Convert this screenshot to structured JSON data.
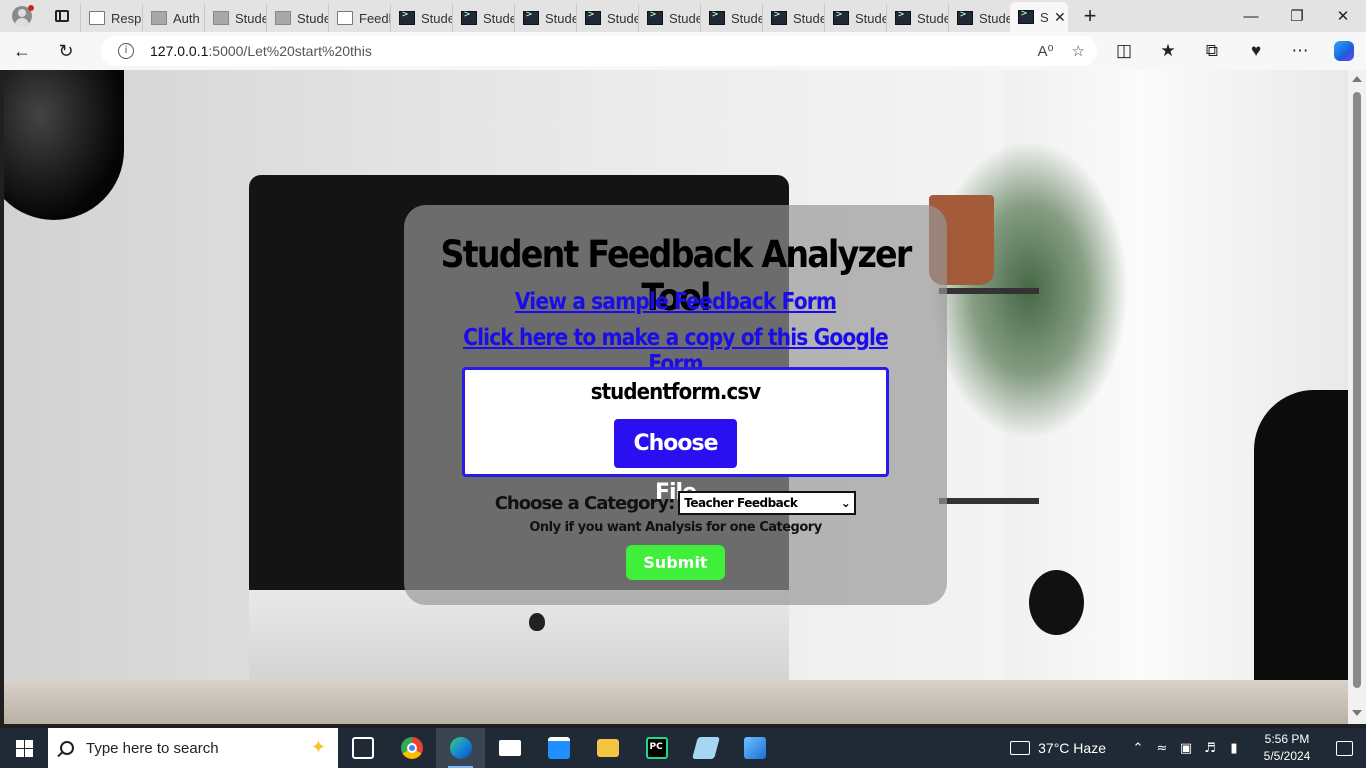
{
  "browser": {
    "tabs": [
      {
        "label": "Respo",
        "icon": "doc-icon"
      },
      {
        "label": "Auth",
        "icon": "image-icon"
      },
      {
        "label": "Stude",
        "icon": "image-icon"
      },
      {
        "label": "Stude",
        "icon": "image-icon"
      },
      {
        "label": "Feedb",
        "icon": "doc-icon"
      },
      {
        "label": "Stude",
        "icon": "terminal-icon"
      },
      {
        "label": "Stude",
        "icon": "terminal-icon"
      },
      {
        "label": "Stude",
        "icon": "terminal-icon"
      },
      {
        "label": "Stude",
        "icon": "terminal-icon"
      },
      {
        "label": "Stude",
        "icon": "terminal-icon"
      },
      {
        "label": "Stude",
        "icon": "terminal-icon"
      },
      {
        "label": "Stude",
        "icon": "terminal-icon"
      },
      {
        "label": "Stude",
        "icon": "terminal-icon"
      },
      {
        "label": "Stude",
        "icon": "terminal-icon"
      },
      {
        "label": "Stude",
        "icon": "terminal-icon"
      }
    ],
    "active_tab": {
      "label": "S",
      "close": "✕"
    },
    "new_tab": "+",
    "window_controls": {
      "minimize": "—",
      "restore": "❐",
      "close": "✕"
    },
    "url_host": "127.0.0.1",
    "url_path": ":5000/Let%20start%20this"
  },
  "page": {
    "title": "Student Feedback Analyzer Tool",
    "link_sample": "View a sample Feedback Form",
    "link_copy": "Click here to make a copy of this Google Form",
    "file_name": "studentform.csv",
    "choose_file": "Choose File",
    "category_label": "Choose a Category:",
    "category_selected": "Teacher Feedback",
    "category_hint": "Only if you want Analysis for one Category",
    "submit": "Submit",
    "colors": {
      "link": "#1a0dea",
      "choose_file_bg": "#2a10f0",
      "submit_bg": "#3fef3a"
    }
  },
  "taskbar": {
    "search_placeholder": "Type here to search",
    "weather": "37°C  Haze",
    "time": "5:56 PM",
    "date": "5/5/2024"
  }
}
